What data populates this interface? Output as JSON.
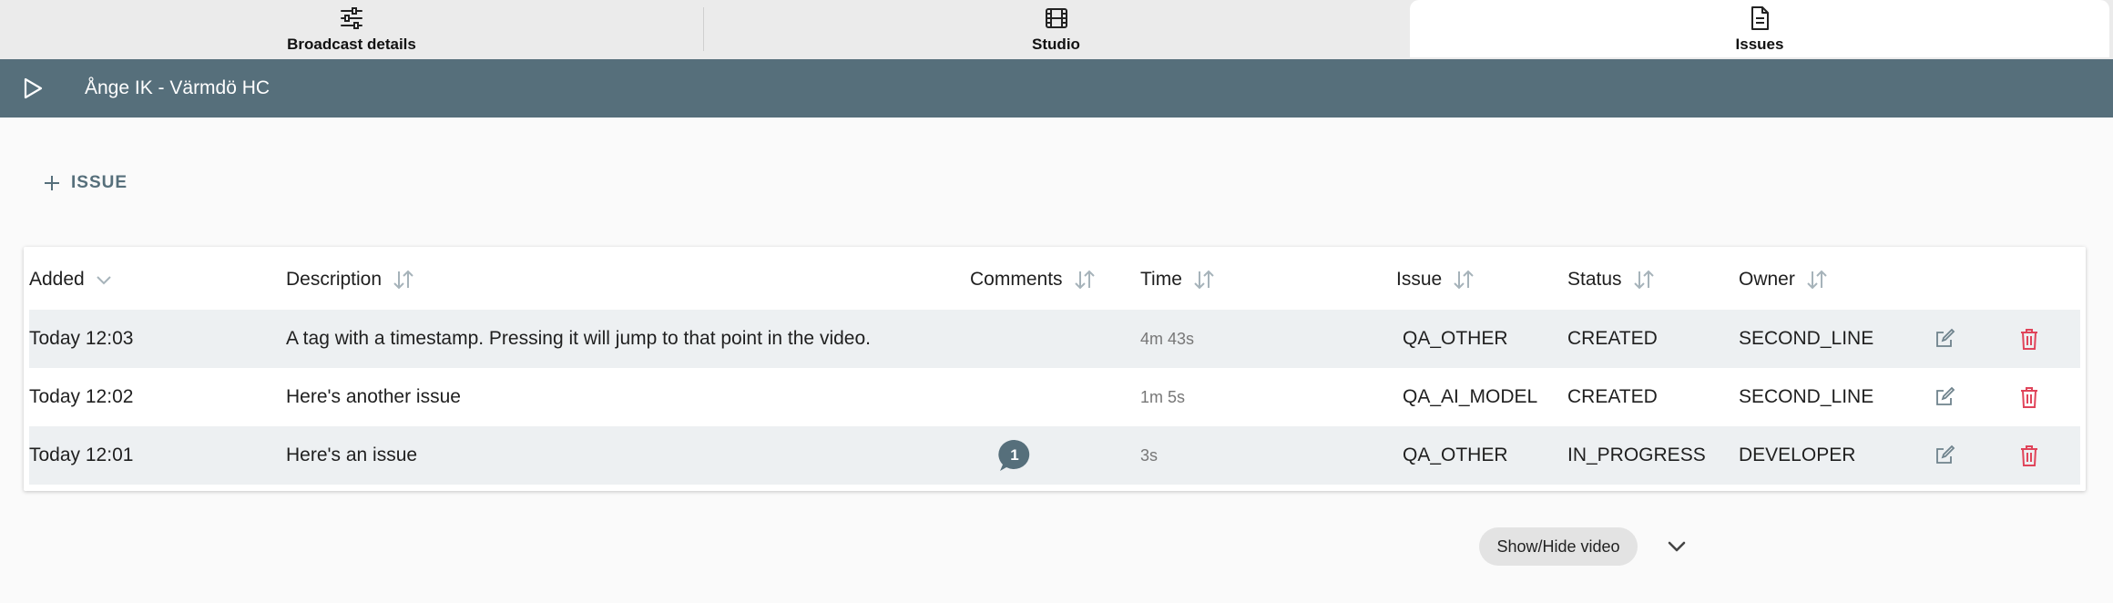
{
  "tabs": [
    {
      "label": "Broadcast details",
      "icon": "sliders-icon"
    },
    {
      "label": "Studio",
      "icon": "film-icon"
    },
    {
      "label": "Issues",
      "icon": "document-icon",
      "active": true
    }
  ],
  "header": {
    "title": "Ånge IK - Värmdö HC",
    "play_icon": "play-icon"
  },
  "add_issue_label": "ISSUE",
  "table": {
    "columns": [
      "Added",
      "Description",
      "Comments",
      "Time",
      "Issue",
      "Status",
      "Owner"
    ],
    "rows": [
      {
        "added": "Today 12:03",
        "description": "A tag with a timestamp. Pressing it will jump to that point in the video.",
        "comments": "",
        "time": "4m 43s",
        "issue": "QA_OTHER",
        "status": "CREATED",
        "owner": "SECOND_LINE"
      },
      {
        "added": "Today 12:02",
        "description": "Here's another issue",
        "comments": "",
        "time": "1m 5s",
        "issue": "QA_AI_MODEL",
        "status": "CREATED",
        "owner": "SECOND_LINE"
      },
      {
        "added": "Today 12:01",
        "description": "Here's an issue",
        "comments": "1",
        "time": "3s",
        "issue": "QA_OTHER",
        "status": "IN_PROGRESS",
        "owner": "DEVELOPER"
      }
    ]
  },
  "show_hide_label": "Show/Hide video",
  "colors": {
    "header_bg": "#566f7b",
    "delete": "#e0445a",
    "badge": "#566f7b"
  }
}
